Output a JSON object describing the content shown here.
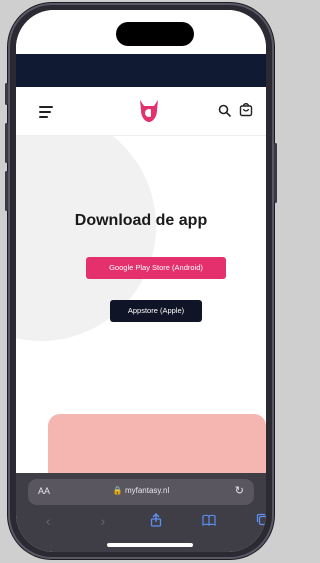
{
  "page": {
    "title": "Download de app"
  },
  "buttons": {
    "google": "Google Play Store (Android)",
    "apple": "Appstore (Apple)"
  },
  "browser": {
    "text_size_label": "AA",
    "url": "myfantasy.nl",
    "reload_icon": "reload-icon"
  },
  "colors": {
    "brand_pink": "#e4316e",
    "dark_navy": "#0f1426",
    "promo_pink": "#f5b6b1"
  }
}
